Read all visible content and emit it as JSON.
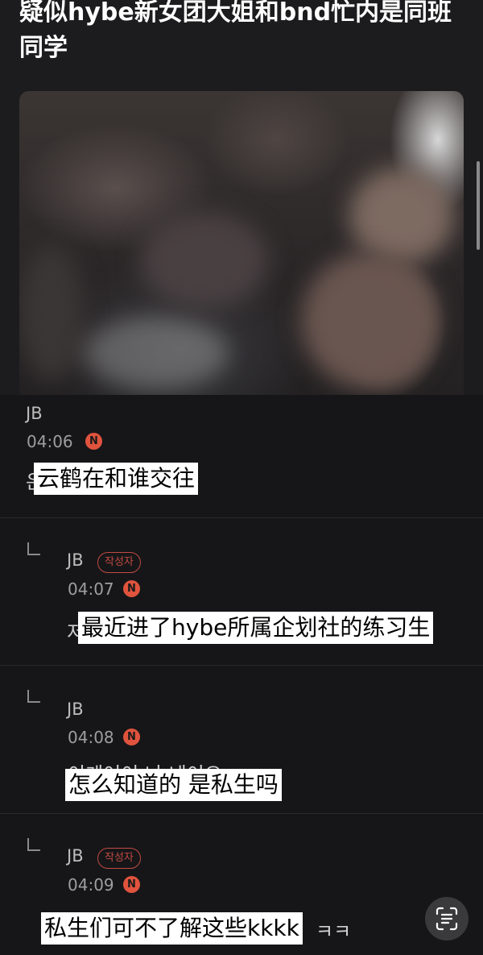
{
  "post": {
    "title": "疑似hybe新女团大姐和bnd忙内是同班同学",
    "photo_alt": ""
  },
  "comments": [
    {
      "author": "JB",
      "time": "04:06",
      "badge": "N",
      "is_reply": false,
      "writer_tag": "",
      "under_text": "은",
      "caption": "云鹤在和谁交往"
    },
    {
      "author": "JB",
      "time": "04:07",
      "badge": "N",
      "is_reply": true,
      "writer_tag": "작성자",
      "under_text": "저",
      "caption": "最近进了hybe所属企划社的练习生"
    },
    {
      "author": "JB",
      "time": "04:08",
      "badge": "N",
      "is_reply": true,
      "writer_tag": "",
      "under_text": "이게어이 나 네이요",
      "caption": "怎么知道的 是私生吗"
    },
    {
      "author": "JB",
      "time": "04:09",
      "badge": "N",
      "is_reply": true,
      "writer_tag": "작성자",
      "under_text": "ㅋㅋ",
      "caption": "私生们可不了解这些kkkk"
    }
  ],
  "icons": {
    "reply": "reply-corner-icon",
    "scan": "text-scan-icon"
  }
}
